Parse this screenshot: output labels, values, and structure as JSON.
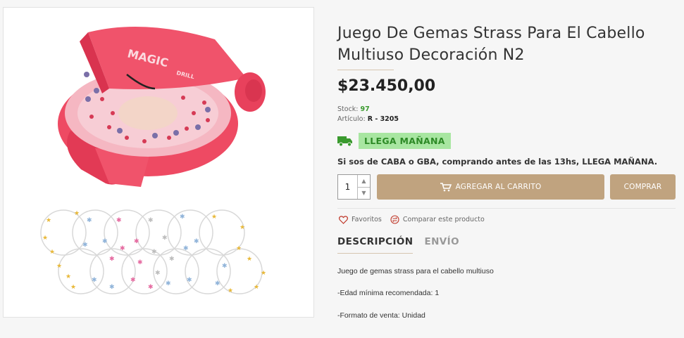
{
  "product": {
    "title": "Juego De Gemas Strass Para El Cabello Multiuso Decoración N2",
    "price": "$23.450,00",
    "stock_label": "Stock:",
    "stock_value": "97",
    "article_label": "Artículo:",
    "article_value": "R - 3205",
    "image_brand_text": "MAGIC",
    "image_sub_text": "DRILL"
  },
  "shipping": {
    "badge": "LLEGA MAÑANA",
    "notice": "Si sos de CABA o GBA, comprando antes de las 13hs, LLEGA MAÑANA."
  },
  "purchase": {
    "quantity": "1",
    "add_to_cart": "AGREGAR AL CARRITO",
    "buy": "COMPRAR"
  },
  "actions": {
    "favorites": "Favoritos",
    "compare": "Comparar este producto"
  },
  "tabs": [
    {
      "label": "DESCRIPCIÓN",
      "active": true
    },
    {
      "label": "ENVÍO",
      "active": false
    }
  ],
  "description": [
    "Juego de gemas strass para el cabello multiuso",
    "-Edad mínima recomendada: 1",
    "-Formato de venta: Unidad"
  ],
  "colors": {
    "accent": "#c0a37f",
    "badge_bg": "#a8e6a1",
    "badge_text": "#2d8a26",
    "stock_green": "#3a9a2e",
    "product_pink": "#f0536b"
  }
}
